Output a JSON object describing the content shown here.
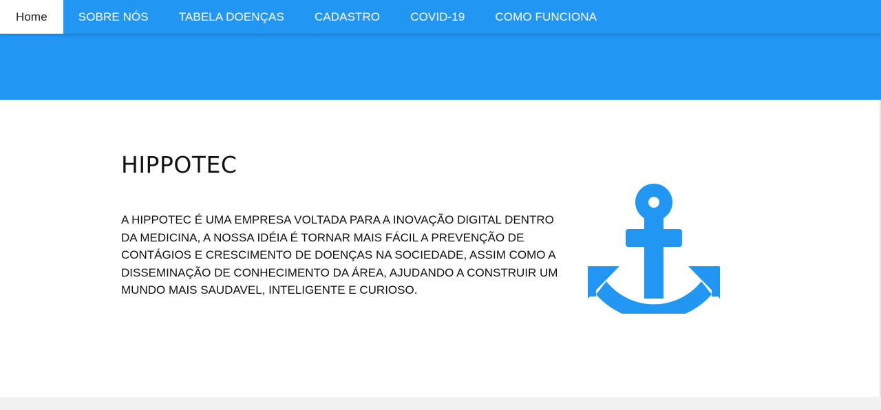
{
  "navbar": {
    "items": [
      {
        "label": "Home",
        "active": true
      },
      {
        "label": "SOBRE NÓS"
      },
      {
        "label": "TABELA DOENÇAS"
      },
      {
        "label": "CADASTRO"
      },
      {
        "label": "COVID-19"
      },
      {
        "label": "COMO FUNCIONA"
      }
    ]
  },
  "main": {
    "title": "HIPPOTEC",
    "description": "A HIPPOTEC É UMA EMPRESA VOLTADA PARA A INOVAÇÃO DIGITAL DENTRO DA MEDICINA, A NOSSA IDÉIA É TORNAR MAIS FÁCIL A PREVENÇÃO DE CONTÁGIOS E CRESCIMENTO DE DOENÇAS NA SOCIEDADE, ASSIM COMO A DISSEMINAÇÃO DE CONHECIMENTO DA ÁREA, AJUDANDO A CONSTRUIR UM MUNDO MAIS SAUDAVEL, INTELIGENTE E CURIOSO.",
    "icon": "anchor-icon"
  },
  "colors": {
    "accent": "#2196f3",
    "text": "#111111",
    "background": "#ffffff",
    "footer": "#f1f1f1"
  }
}
